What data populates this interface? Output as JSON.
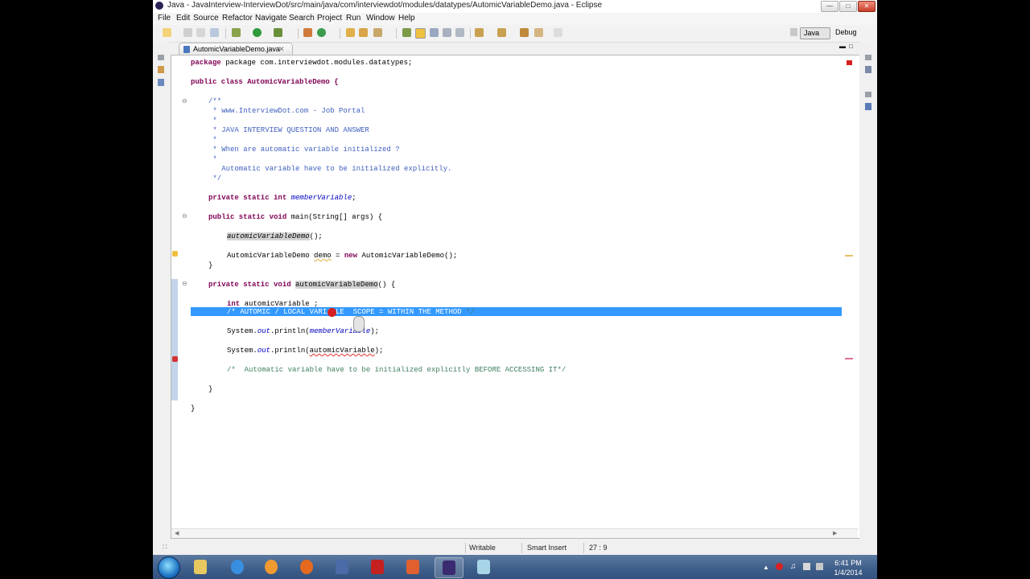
{
  "window": {
    "title": "Java - JavaInterview-InterviewDot/src/main/java/com/interviewdot/modules/datatypes/AutomicVariableDemo.java - Eclipse"
  },
  "menu": [
    "File",
    "Edit",
    "Source",
    "Refactor",
    "Navigate",
    "Search",
    "Project",
    "Run",
    "Window",
    "Help"
  ],
  "perspectives": {
    "java": "Java",
    "debug": "Debug"
  },
  "editor": {
    "tab_label": "AutomicVariableDemo.java",
    "lines": {
      "l1": "package com.interviewdot.modules.datatypes;",
      "l2": "public class AutomicVariableDemo {",
      "l3": "/**",
      "l4": " * www.InterviewDot.com - Job Portal",
      "l5": " *",
      "l6": " * JAVA INTERVIEW QUESTION AND ANSWER",
      "l7": " *",
      "l8": " * When are automatic variable initialized ?",
      "l9": " *",
      "l10": "   Automatic variable have to be initialized explicitly.",
      "l11": " */",
      "l12_kw": "private static int ",
      "l12_var": "memberVariable",
      "l12_end": ";",
      "l13_kw": "public static void ",
      "l13_rest": "main(String[] args) {",
      "l14_call": "automicVariableDemo",
      "l14_end": "();",
      "l15_a": "AutomicVariableDemo ",
      "l15_b": "demo",
      "l15_c": " = ",
      "l15_kw": "new",
      "l15_d": " AutomicVariableDemo();",
      "l16": "}",
      "l17_kw": "private static void ",
      "l17_name": "automicVariableDemo",
      "l17_end": "() {",
      "l18_kw": "int",
      "l18_rest": " automicVariable ;",
      "l19_sel": "/* AUTOMIC / LOCAL VARIABLE  SCOPE = WITHIN THE METHOD",
      "l19_end": " */",
      "l20_a": "System.",
      "l20_out": "out",
      "l20_b": ".println(",
      "l20_var": "memberVariable",
      "l20_c": ");",
      "l21_a": "System.",
      "l21_out": "out",
      "l21_b": ".println(",
      "l21_var": "automicVariable",
      "l21_c": ");",
      "l22": "/*  Automatic variable have to be initialized explicitly BEFORE ACCESSING IT*/",
      "l23": "}",
      "l24": "}"
    }
  },
  "status": {
    "writable": "Writable",
    "insert_mode": "Smart Insert",
    "position": "27 : 9"
  },
  "taskbar": {
    "time": "6:41 PM",
    "date": "1/4/2014"
  }
}
